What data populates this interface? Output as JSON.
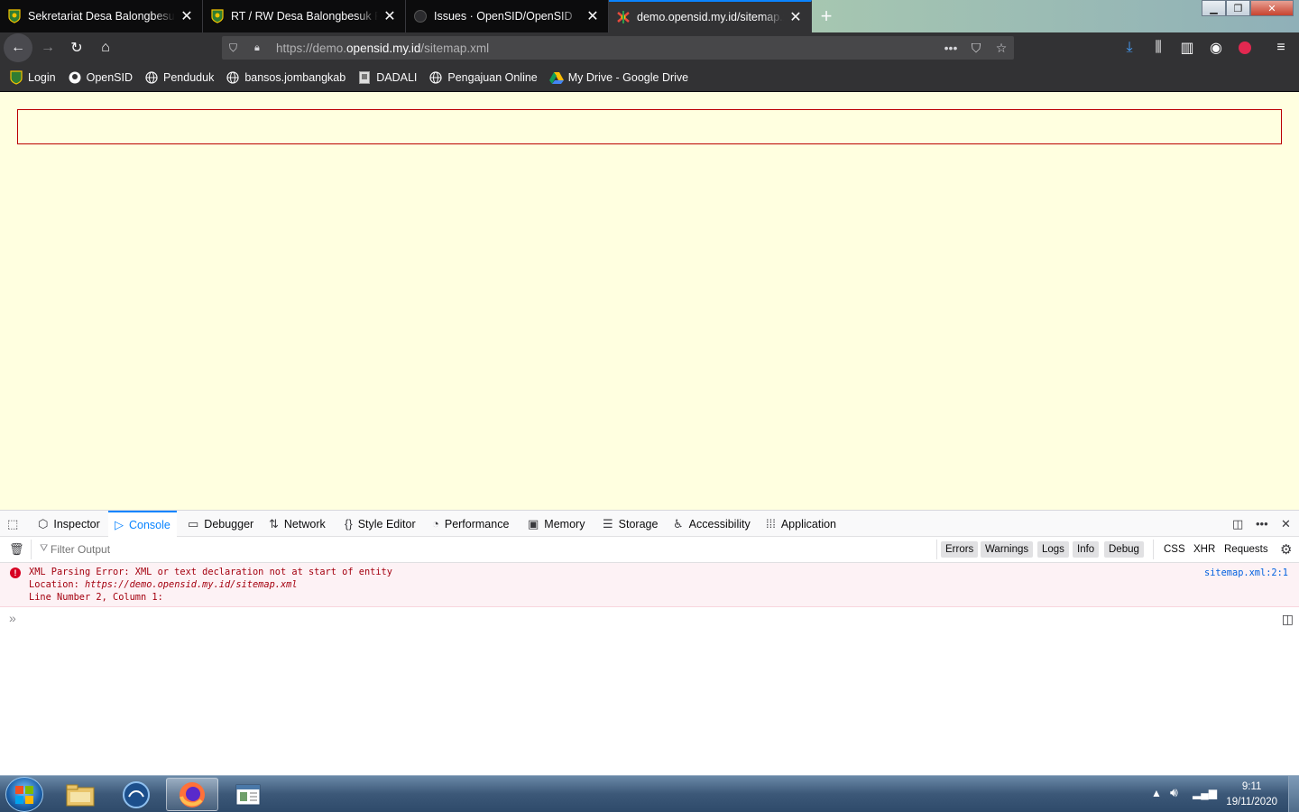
{
  "tabs": [
    {
      "title": "Sekretariat Desa Balongbesuk - ",
      "icon": "desa-logo-icon",
      "active": false
    },
    {
      "title": "RT / RW Desa Balongbesuk Pemerintah",
      "icon": "desa-logo-icon",
      "active": false
    },
    {
      "title": "Issues · OpenSID/OpenSID",
      "icon": "github-icon",
      "active": false
    },
    {
      "title": "demo.opensid.my.id/sitemap.xml",
      "icon": "opensid-icon",
      "active": true
    }
  ],
  "url": {
    "prefix": "https://demo.",
    "host": "opensid.my.id",
    "path": "/sitemap.xml"
  },
  "bookmarks": [
    {
      "label": "Login",
      "icon": "desa-logo-icon"
    },
    {
      "label": "OpenSID",
      "icon": "github-icon"
    },
    {
      "label": "Penduduk",
      "icon": "globe-icon"
    },
    {
      "label": "bansos.jombangkab",
      "icon": "globe-icon"
    },
    {
      "label": "DADALI",
      "icon": "dadali-icon"
    },
    {
      "label": "Pengajuan Online",
      "icon": "globe-icon"
    },
    {
      "label": "My Drive - Google Drive",
      "icon": "google-drive-icon"
    }
  ],
  "devtools": {
    "tabs": [
      "Inspector",
      "Console",
      "Debugger",
      "Network",
      "Style Editor",
      "Performance",
      "Memory",
      "Storage",
      "Accessibility",
      "Application"
    ],
    "selected_tab": "Console",
    "filter_placeholder": "Filter Output",
    "level_filters": [
      "Errors",
      "Warnings",
      "Logs",
      "Info",
      "Debug"
    ],
    "type_filters": [
      "CSS",
      "XHR",
      "Requests"
    ],
    "error": {
      "line1": "XML Parsing Error: XML or text declaration not at start of entity",
      "location_label": "Location: ",
      "location_url": "https://demo.opensid.my.id/sitemap.xml",
      "line3": "Line Number 2, Column 1:",
      "source": "sitemap.xml:2:1"
    }
  },
  "taskbar": {
    "time": "9:11",
    "date": "19/11/2020",
    "apps": [
      "file-explorer-icon",
      "app-swirl-icon",
      "firefox-icon",
      "document-viewer-icon"
    ]
  },
  "colors": {
    "accent": "#0a84ff",
    "error": "#a4000f",
    "xml_bg": "#ffffe0"
  }
}
